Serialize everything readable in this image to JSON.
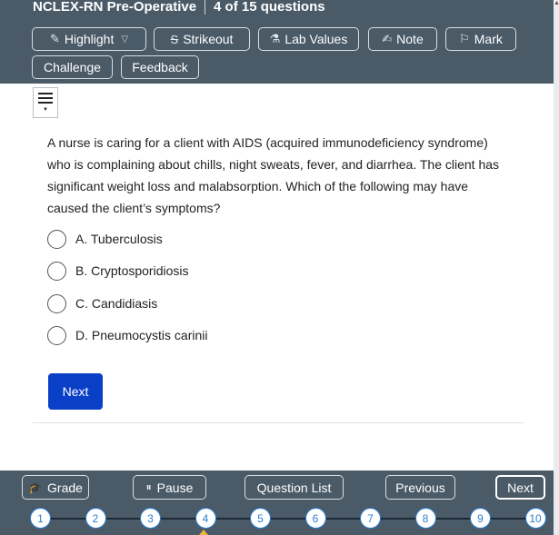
{
  "header": {
    "exam_title": "NCLEX-RN Pre-Operative",
    "progress_text": "4 of 15 questions"
  },
  "toolbar": {
    "highlight": "Highlight",
    "strikeout": "Strikeout",
    "lab_values": "Lab Values",
    "note": "Note",
    "mark": "Mark",
    "challenge": "Challenge",
    "feedback": "Feedback"
  },
  "question": {
    "text": "A nurse is caring for a client with AIDS (acquired immunodeficiency syndrome) who is complaining about chills, night sweats, fever, and diarrhea. The client has significant weight loss and malabsorption. Which of the following may have caused the client’s symptoms?",
    "options": [
      "A. Tuberculosis",
      "B. Cryptosporidiosis",
      "C. Candidiasis",
      "D. Pneumocystis carinii"
    ],
    "next_label": "Next"
  },
  "footer": {
    "grade": "Grade",
    "pause": "Pause",
    "question_list": "Question List",
    "previous": "Previous",
    "next": "Next",
    "question_numbers": [
      "1",
      "2",
      "3",
      "4",
      "5",
      "6",
      "7",
      "8",
      "9",
      "10"
    ],
    "current_question": 4
  },
  "colors": {
    "toolbar_bg": "#4a5a67",
    "primary_button": "#0a3fc7",
    "question_number": "#2d7fd3",
    "current_marker": "#f3b23a"
  }
}
